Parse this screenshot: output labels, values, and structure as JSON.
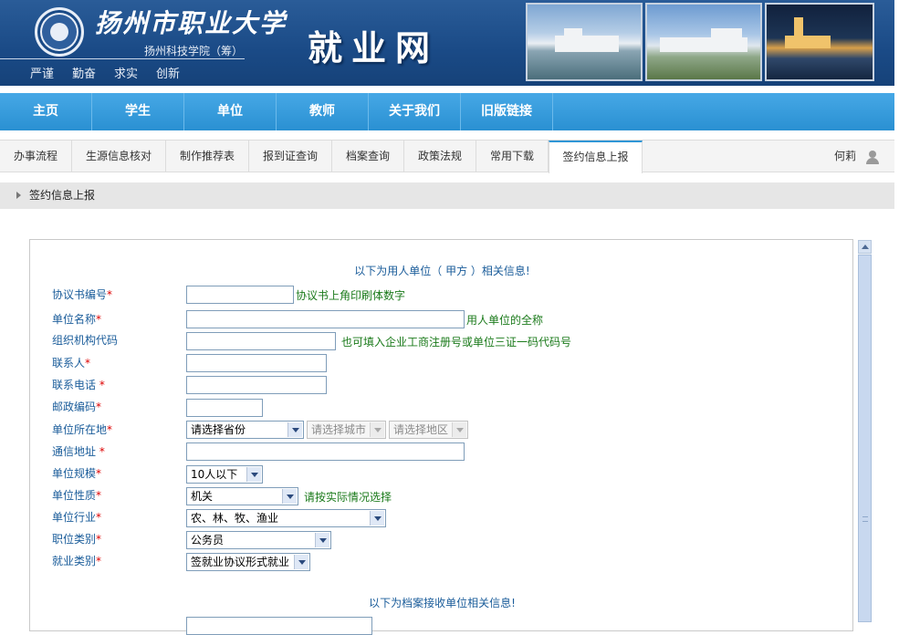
{
  "header": {
    "school_name": "扬州市职业大学",
    "school_sub": "扬州科技学院（筹）",
    "motto": [
      "严谨",
      "勤奋",
      "求实",
      "创新"
    ],
    "site_title": "就业网"
  },
  "main_nav": [
    "主页",
    "学生",
    "单位",
    "教师",
    "关于我们",
    "旧版链接"
  ],
  "sub_tabs": [
    "办事流程",
    "生源信息核对",
    "制作推荐表",
    "报到证查询",
    "档案查询",
    "政策法规",
    "常用下载",
    "签约信息上报"
  ],
  "user": {
    "name": "何莉",
    "icon": "user-icon"
  },
  "breadcrumb": "签约信息上报",
  "form": {
    "section1_title": "以下为用人单位（ 甲方 ）相关信息!",
    "section2_title": "以下为档案接收单位相关信息!",
    "fields": {
      "agreement_no": {
        "label": "协议书编号",
        "value": "",
        "hint": "协议书上角印刷体数字"
      },
      "unit_name": {
        "label": "单位名称",
        "value": "",
        "hint": "用人单位的全称"
      },
      "org_code": {
        "label": "组织机构代码",
        "value": "",
        "hint": "也可填入企业工商注册号或单位三证一码代码号"
      },
      "contact": {
        "label": "联系人",
        "value": ""
      },
      "phone": {
        "label": "联系电话 ",
        "value": ""
      },
      "postcode": {
        "label": "邮政编码",
        "value": ""
      },
      "location": {
        "label": "单位所在地",
        "province": "请选择省份",
        "city": "请选择城市",
        "district": "请选择地区"
      },
      "address": {
        "label": "通信地址 ",
        "value": ""
      },
      "scale": {
        "label": "单位规模",
        "value": "10人以下"
      },
      "nature": {
        "label": "单位性质",
        "value": "机关",
        "hint": "请按实际情况选择"
      },
      "industry": {
        "label": "单位行业",
        "value": "农、林、牧、渔业"
      },
      "job_type": {
        "label": "职位类别",
        "value": "公务员"
      },
      "employment_type": {
        "label": "就业类别",
        "value": "签就业协议形式就业"
      }
    },
    "required_mark": "*"
  }
}
